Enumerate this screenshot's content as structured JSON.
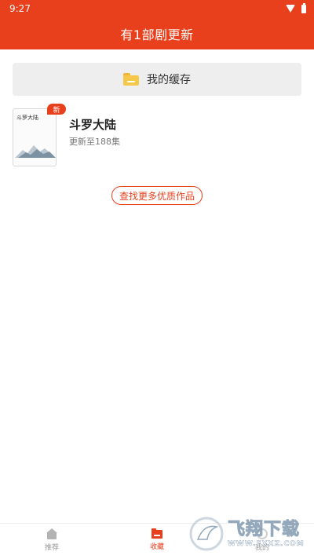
{
  "status_bar": {
    "time": "9:27"
  },
  "header": {
    "title": "有1部剧更新"
  },
  "cache_button": {
    "label": "我的缓存"
  },
  "dramas": [
    {
      "cover_title": "斗罗大陆",
      "badge": "新",
      "title": "斗罗大陆",
      "subtitle": "更新至188集"
    }
  ],
  "find_more": {
    "label": "查找更多优质作品"
  },
  "bottom_nav": {
    "items": [
      {
        "label": "推荐",
        "icon": "home-icon"
      },
      {
        "label": "收藏",
        "icon": "folder-icon",
        "active": true
      },
      {
        "label": "我的",
        "icon": "user-icon"
      }
    ]
  },
  "watermark": {
    "main": "飞翔下载",
    "url": "WWW.FXXZ.COM"
  },
  "colors": {
    "accent": "#e8401c",
    "folder": "#f6c84a"
  }
}
